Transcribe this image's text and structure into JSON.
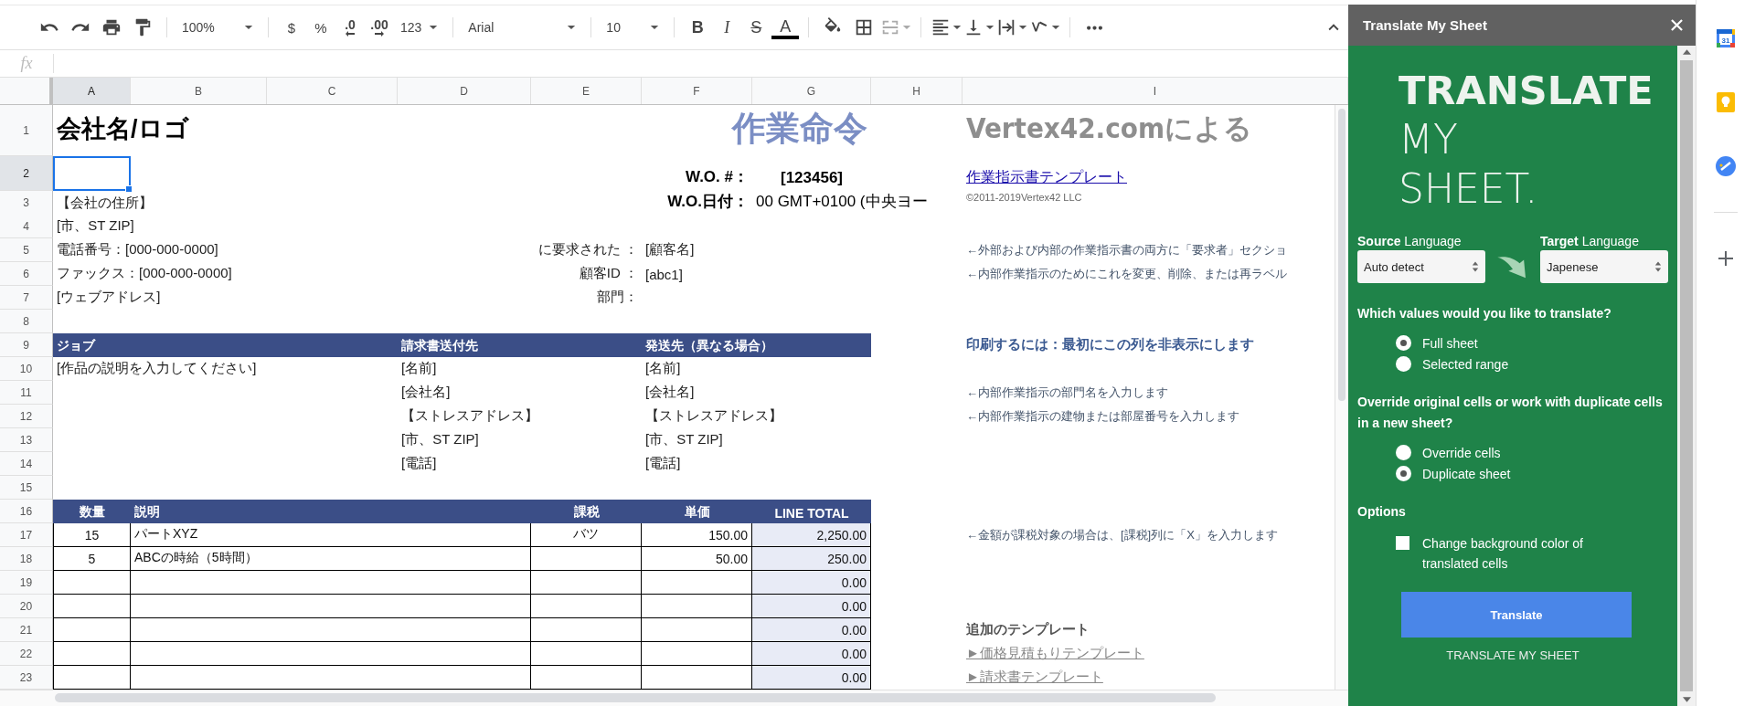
{
  "toolbar": {
    "zoom": "100%",
    "currency": "$",
    "percent": "%",
    "decimal_decrease": ".0",
    "decimal_increase": ".00",
    "number_format": "123",
    "font": "Arial",
    "font_size": "10",
    "bold": "B",
    "italic": "I",
    "strikethrough": "S",
    "text_color": "A"
  },
  "formula_bar": {
    "label": "fx"
  },
  "columns": [
    {
      "label": "A",
      "selected": true
    },
    {
      "label": "B",
      "selected": false
    },
    {
      "label": "C",
      "selected": false
    },
    {
      "label": "D",
      "selected": false
    },
    {
      "label": "E",
      "selected": false
    },
    {
      "label": "F",
      "selected": false
    },
    {
      "label": "G",
      "selected": false
    },
    {
      "label": "H",
      "selected": false
    },
    {
      "label": "I",
      "selected": false
    }
  ],
  "rows": [
    {
      "number": "1",
      "selected": false,
      "kind": "plain",
      "cells": {
        "a": {
          "text": "会社名/ロゴ",
          "kind": "title"
        },
        "g": {
          "text": "作業命令",
          "kind": "doc-title"
        },
        "i": {
          "text": "Vertex42.comによる",
          "kind": "brand"
        }
      }
    },
    {
      "number": "2",
      "selected": true,
      "kind": "plain",
      "cells": {
        "f": {
          "text": "W.O. #：",
          "kind": "label-right"
        },
        "g": {
          "text": "[123456]",
          "kind": "strong-center"
        },
        "i": {
          "text": "作業指示書テンプレート",
          "kind": "link"
        }
      }
    },
    {
      "number": "3",
      "selected": false,
      "kind": "plain",
      "cells": {
        "a": {
          "text": "【会社の住所】",
          "kind": "text"
        },
        "f": {
          "text": "W.O.日付：",
          "kind": "label-right"
        },
        "g": {
          "text": "00 GMT+0100 (中央ヨー",
          "kind": "value"
        },
        "i": {
          "text": "©2011-2019Vertex42 LLC",
          "kind": "copyright"
        }
      }
    },
    {
      "number": "4",
      "selected": false,
      "kind": "plain",
      "cells": {
        "a": {
          "text": "[市、ST ZIP]",
          "kind": "text"
        }
      }
    },
    {
      "number": "5",
      "selected": false,
      "kind": "plain",
      "cells": {
        "a": {
          "text": "電話番号：[000-000-0000]",
          "kind": "text"
        },
        "e": {
          "text": "に要求された ：",
          "kind": "right"
        },
        "f": {
          "text": "[顧客名]",
          "kind": "text"
        },
        "i": {
          "text": "←外部および内部の作業指示書の両方に「要求者」セクショ",
          "kind": "note"
        }
      }
    },
    {
      "number": "6",
      "selected": false,
      "kind": "plain",
      "cells": {
        "a": {
          "text": "ファックス：[000-000-0000]",
          "kind": "text"
        },
        "e": {
          "text": "顧客ID ：",
          "kind": "right"
        },
        "f": {
          "text": "[abc1]",
          "kind": "text"
        },
        "i": {
          "text": "←内部作業指示のためにこれを変更、削除、または再ラベル",
          "kind": "note"
        }
      }
    },
    {
      "number": "7",
      "selected": false,
      "kind": "plain",
      "cells": {
        "a": {
          "text": "[ウェブアドレス]",
          "kind": "text"
        },
        "e": {
          "text": "部門：",
          "kind": "right"
        }
      }
    },
    {
      "number": "8",
      "selected": false,
      "kind": "plain",
      "cells": {}
    },
    {
      "number": "9",
      "selected": false,
      "kind": "band",
      "cells": {
        "a": {
          "text": "ジョブ",
          "kind": "band"
        },
        "d": {
          "text": "請求書送付先",
          "kind": "band"
        },
        "f": {
          "text": "発送先（異なる場合）",
          "kind": "band"
        },
        "i": {
          "text": "印刷するには：最初にこの列を非表示にします",
          "kind": "print-note"
        }
      }
    },
    {
      "number": "10",
      "selected": false,
      "kind": "plain",
      "cells": {
        "a": {
          "text": "[作品の説明を入力してください]",
          "kind": "text"
        },
        "d": {
          "text": "[名前]",
          "kind": "text"
        },
        "f": {
          "text": "[名前]",
          "kind": "text"
        }
      }
    },
    {
      "number": "11",
      "selected": false,
      "kind": "plain",
      "cells": {
        "d": {
          "text": "[会社名]",
          "kind": "text"
        },
        "f": {
          "text": "[会社名]",
          "kind": "text"
        },
        "i": {
          "text": "←内部作業指示の部門名を入力します",
          "kind": "note"
        }
      }
    },
    {
      "number": "12",
      "selected": false,
      "kind": "plain",
      "cells": {
        "d": {
          "text": "【ストレスアドレス】",
          "kind": "text"
        },
        "f": {
          "text": "【ストレスアドレス】",
          "kind": "text"
        },
        "i": {
          "text": "←内部作業指示の建物または部屋番号を入力します",
          "kind": "note"
        }
      }
    },
    {
      "number": "13",
      "selected": false,
      "kind": "plain",
      "cells": {
        "d": {
          "text": "[市、ST ZIP]",
          "kind": "text"
        },
        "f": {
          "text": "[市、ST ZIP]",
          "kind": "text"
        }
      }
    },
    {
      "number": "14",
      "selected": false,
      "kind": "plain",
      "cells": {
        "d": {
          "text": "[電話]",
          "kind": "text"
        },
        "f": {
          "text": "[電話]",
          "kind": "text"
        }
      }
    },
    {
      "number": "15",
      "selected": false,
      "kind": "plain",
      "cells": {}
    },
    {
      "number": "16",
      "selected": false,
      "kind": "band",
      "cells": {
        "a": {
          "text": "数量",
          "kind": "band-center"
        },
        "b": {
          "text": "説明",
          "kind": "band"
        },
        "e": {
          "text": "課税",
          "kind": "band-center"
        },
        "f": {
          "text": "単価",
          "kind": "band-center"
        },
        "g": {
          "text": "LINE TOTAL",
          "kind": "band-center"
        }
      }
    },
    {
      "number": "17",
      "selected": false,
      "kind": "table",
      "cells": {
        "a": {
          "text": "15",
          "kind": "center"
        },
        "b": {
          "text": "パートXYZ",
          "kind": "text"
        },
        "e": {
          "text": "バツ",
          "kind": "center"
        },
        "f": {
          "text": "150.00",
          "kind": "right"
        },
        "g": {
          "text": "2,250.00",
          "kind": "right"
        },
        "i": {
          "text": "←金額が課税対象の場合は、[課税]列に「X」を入力します",
          "kind": "note"
        }
      }
    },
    {
      "number": "18",
      "selected": false,
      "kind": "table",
      "cells": {
        "a": {
          "text": "5",
          "kind": "center"
        },
        "b": {
          "text": "ABCの時給（5時間）",
          "kind": "text"
        },
        "f": {
          "text": "50.00",
          "kind": "right"
        },
        "g": {
          "text": "250.00",
          "kind": "right"
        }
      }
    },
    {
      "number": "19",
      "selected": false,
      "kind": "table",
      "cells": {
        "g": {
          "text": "0.00",
          "kind": "right"
        }
      }
    },
    {
      "number": "20",
      "selected": false,
      "kind": "table",
      "cells": {
        "g": {
          "text": "0.00",
          "kind": "right"
        }
      }
    },
    {
      "number": "21",
      "selected": false,
      "kind": "table",
      "cells": {
        "g": {
          "text": "0.00",
          "kind": "right"
        },
        "i": {
          "text": "追加のテンプレート",
          "kind": "template-heading"
        }
      }
    },
    {
      "number": "22",
      "selected": false,
      "kind": "table",
      "cells": {
        "g": {
          "text": "0.00",
          "kind": "right"
        },
        "i": {
          "text": "►価格見積もりテンプレート",
          "kind": "template-link"
        }
      }
    },
    {
      "number": "23",
      "selected": false,
      "kind": "table",
      "cells": {
        "g": {
          "text": "0.00",
          "kind": "right"
        },
        "i": {
          "text": "►請求書テンプレート",
          "kind": "template-link"
        }
      }
    }
  ],
  "sidebar": {
    "title": "Translate My Sheet",
    "logo": [
      "TRANSLATE",
      "MY",
      "SHEET."
    ],
    "source_label": "**Source** Language",
    "source_value": "Auto detect",
    "target_label": "**Target** Language",
    "target_value": "Japenese",
    "groups": [
      {
        "question": "Which values would you like to translate?",
        "options": [
          {
            "label": "Full sheet",
            "selected": true
          },
          {
            "label": "Selected range",
            "selected": false
          }
        ]
      },
      {
        "question": "Override original cells or work with duplicate cells in a new sheet?",
        "options": [
          {
            "label": "Override cells",
            "selected": false
          },
          {
            "label": "Duplicate sheet",
            "selected": true
          }
        ]
      }
    ],
    "options_heading": "Options",
    "checkbox": {
      "label": "Change background color of translated cells",
      "checked": false
    },
    "button": "Translate",
    "footer": "TRANSLATE MY SHEET"
  },
  "rail": {
    "calendar_day": "31"
  }
}
